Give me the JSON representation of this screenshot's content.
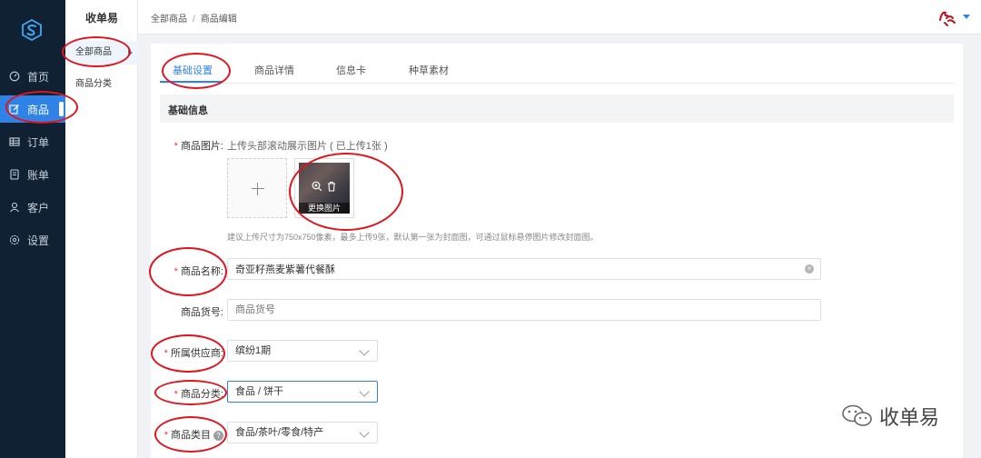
{
  "sidebar": {
    "items": [
      {
        "label": "首页",
        "icon": "dashboard-icon"
      },
      {
        "label": "商品",
        "icon": "edit-icon",
        "active": true
      },
      {
        "label": "订单",
        "icon": "table-icon"
      },
      {
        "label": "账单",
        "icon": "bill-icon"
      },
      {
        "label": "客户",
        "icon": "user-icon"
      },
      {
        "label": "设置",
        "icon": "settings-icon"
      }
    ]
  },
  "subnav": {
    "title": "收单易",
    "items": [
      {
        "label": "全部商品",
        "active": true
      },
      {
        "label": "商品分类"
      }
    ]
  },
  "header": {
    "breadcrumb": [
      "全部商品",
      "商品编辑"
    ],
    "separator": "/"
  },
  "tabs": [
    {
      "label": "基础设置",
      "active": true
    },
    {
      "label": "商品详情"
    },
    {
      "label": "信息卡"
    },
    {
      "label": "种草素材"
    }
  ],
  "section": {
    "title": "基础信息"
  },
  "form": {
    "images": {
      "label": "商品图片:",
      "hint": "上传头部滚动展示图片 ( 已上传1张 )",
      "replace_label": "更换图片",
      "note": "建议上传尺寸为750x750像素，最多上传9张，默认第一张为封面图，可通过鼠标悬停图片修改封面图。"
    },
    "name": {
      "label": "商品名称:",
      "value": "奇亚籽燕麦紫薯代餐酥"
    },
    "sku": {
      "label": "商品货号:",
      "placeholder": "商品货号"
    },
    "supplier": {
      "label": "所属供应商:",
      "value": "缤纷1期"
    },
    "category": {
      "label": "商品分类:",
      "value": "食品 / 饼干"
    },
    "type": {
      "label": "商品类目",
      "value": "食品/茶叶/零食/特产"
    }
  },
  "watermark": {
    "text": "收单易"
  },
  "colors": {
    "primary": "#2f83e6",
    "nav_bg": "#0f2133",
    "required": "#e53935",
    "annotation": "#e0141e"
  }
}
